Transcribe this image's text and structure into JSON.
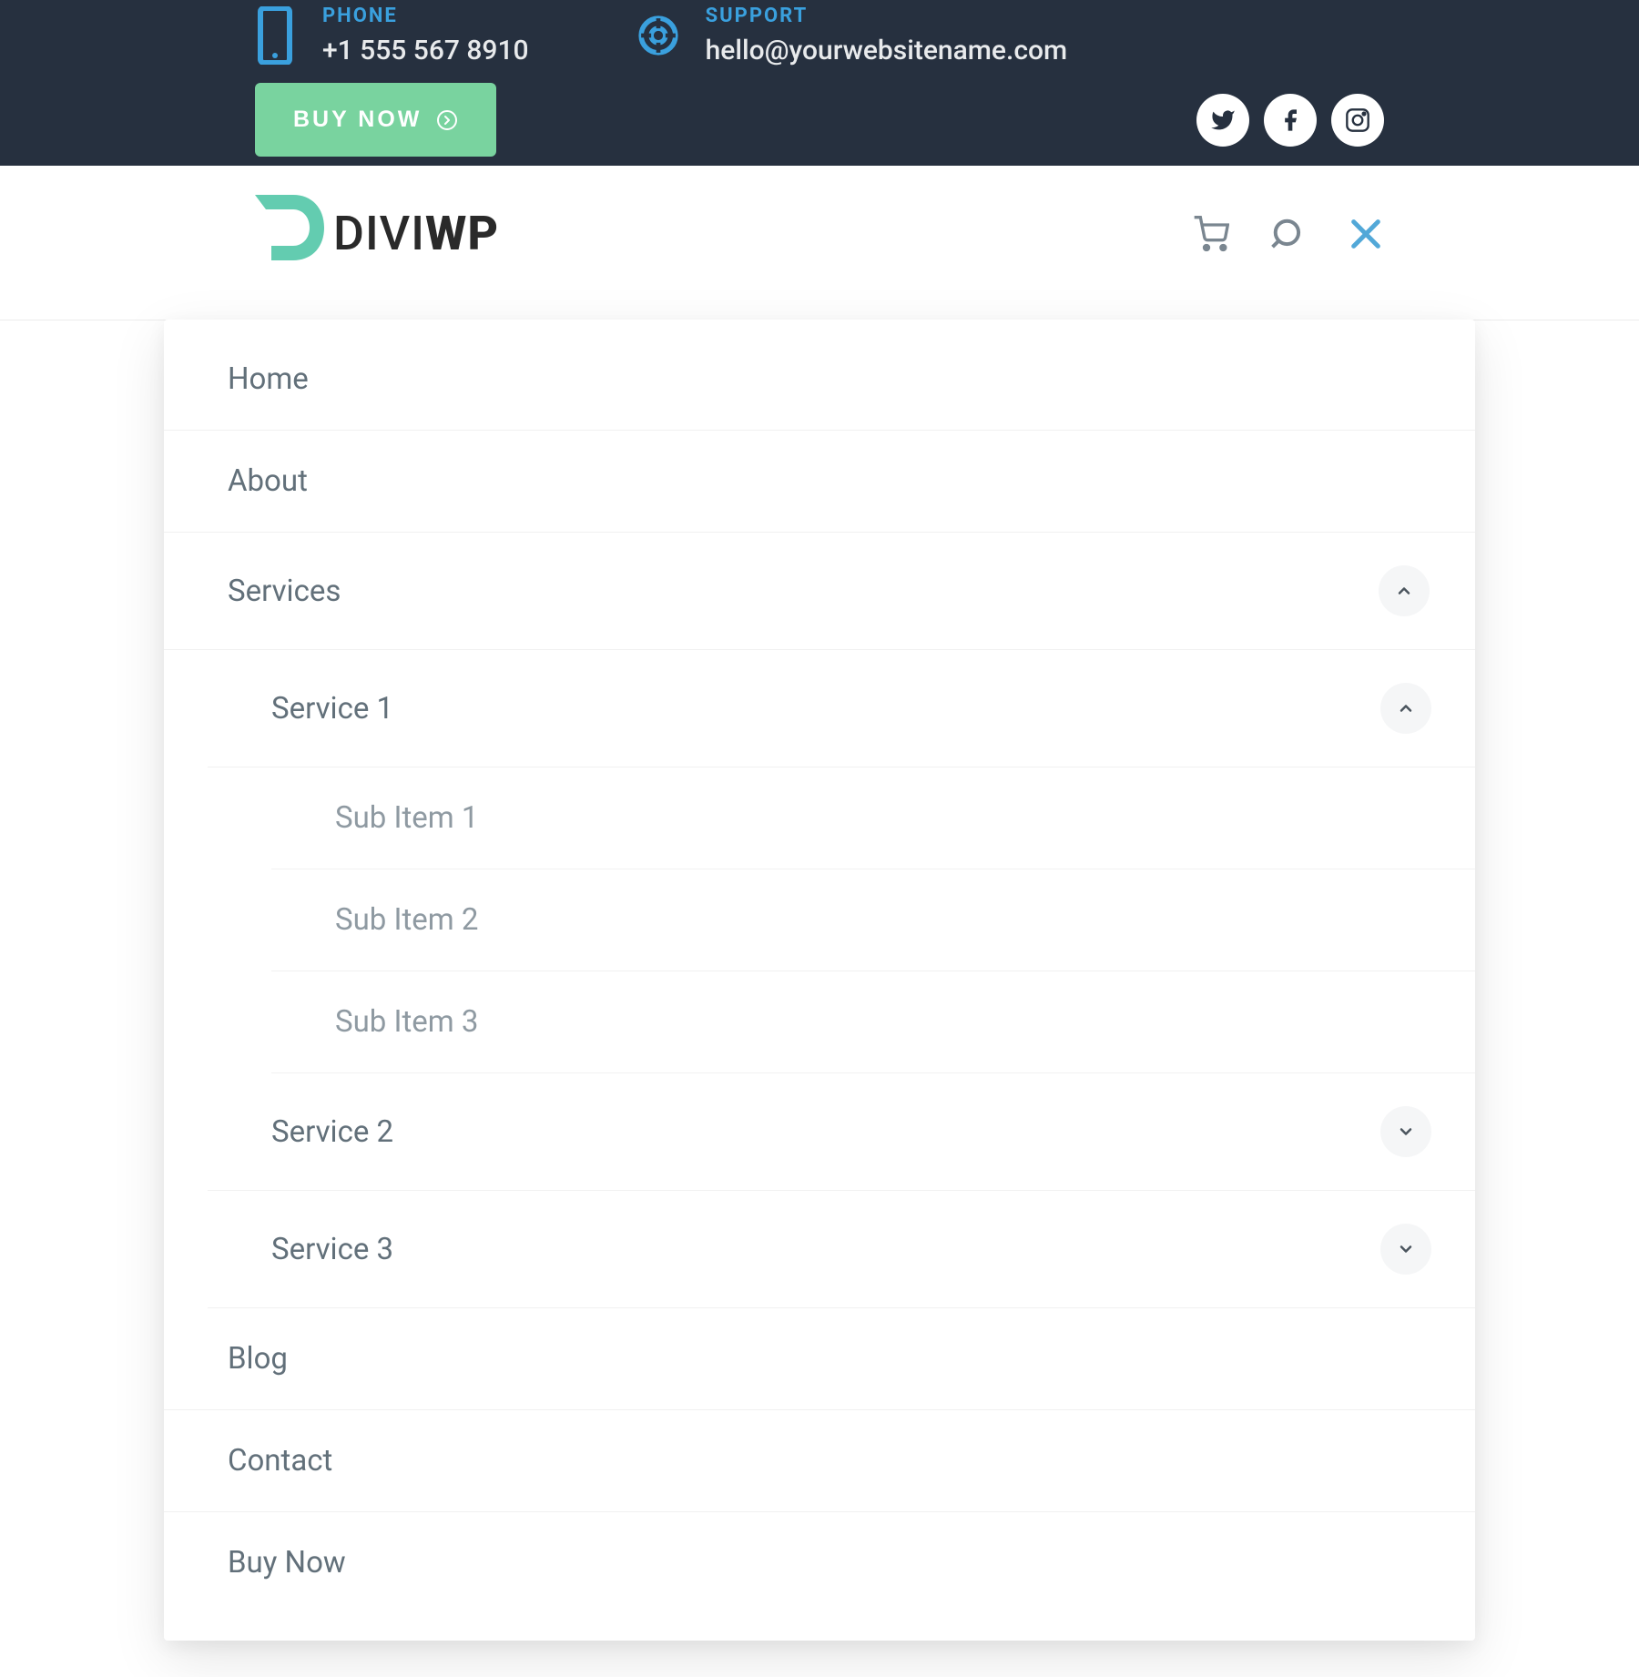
{
  "topbar": {
    "phone_label": "PHONE",
    "phone_value": "+1 555 567 8910",
    "support_label": "SUPPORT",
    "support_value": "hello@yourwebsitename.com",
    "buy_label": "BUY NOW",
    "socials": [
      "twitter",
      "facebook",
      "instagram"
    ]
  },
  "logo": {
    "part1": "DIVI",
    "part2": "WP"
  },
  "nav": {
    "icons": [
      "cart",
      "search",
      "close"
    ]
  },
  "menu": {
    "home": "Home",
    "about": "About",
    "services": "Services",
    "service1": "Service 1",
    "sub1": "Sub Item 1",
    "sub2": "Sub Item 2",
    "sub3": "Sub Item 3",
    "service2": "Service 2",
    "service3": "Service 3",
    "blog": "Blog",
    "contact": "Contact",
    "buynow": "Buy Now"
  },
  "colors": {
    "topbar_bg": "#26303f",
    "accent_blue": "#3aa0de",
    "button_green": "#79d39f",
    "logo_teal": "#63ccb0",
    "text_muted": "#62707a"
  }
}
